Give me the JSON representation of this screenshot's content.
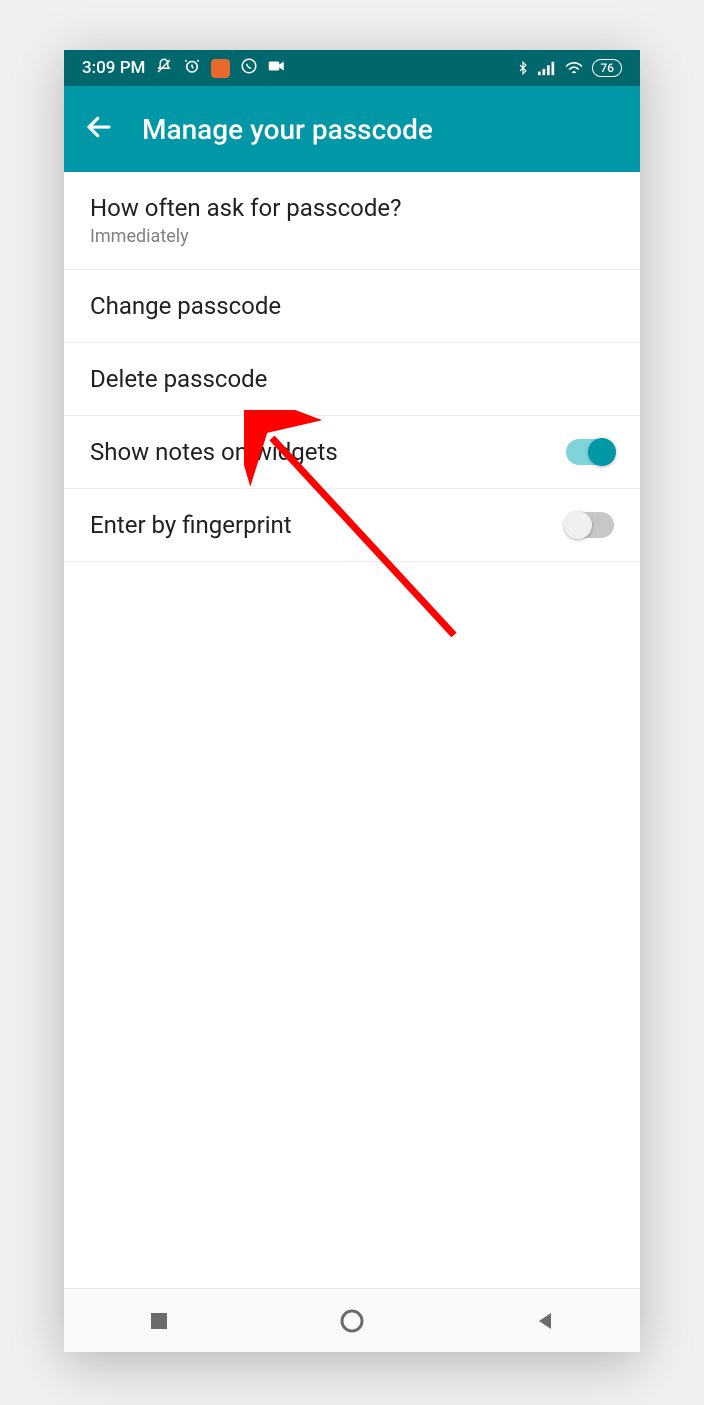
{
  "status": {
    "time": "3:09 PM",
    "battery": "76"
  },
  "header": {
    "title": "Manage your passcode"
  },
  "rows": {
    "ask": {
      "title": "How often ask for passcode?",
      "subtitle": "Immediately"
    },
    "change": {
      "title": "Change passcode"
    },
    "delete": {
      "title": "Delete passcode"
    },
    "widgets": {
      "title": "Show notes on widgets",
      "enabled": true
    },
    "fingerprint": {
      "title": "Enter by fingerprint",
      "enabled": false
    }
  }
}
